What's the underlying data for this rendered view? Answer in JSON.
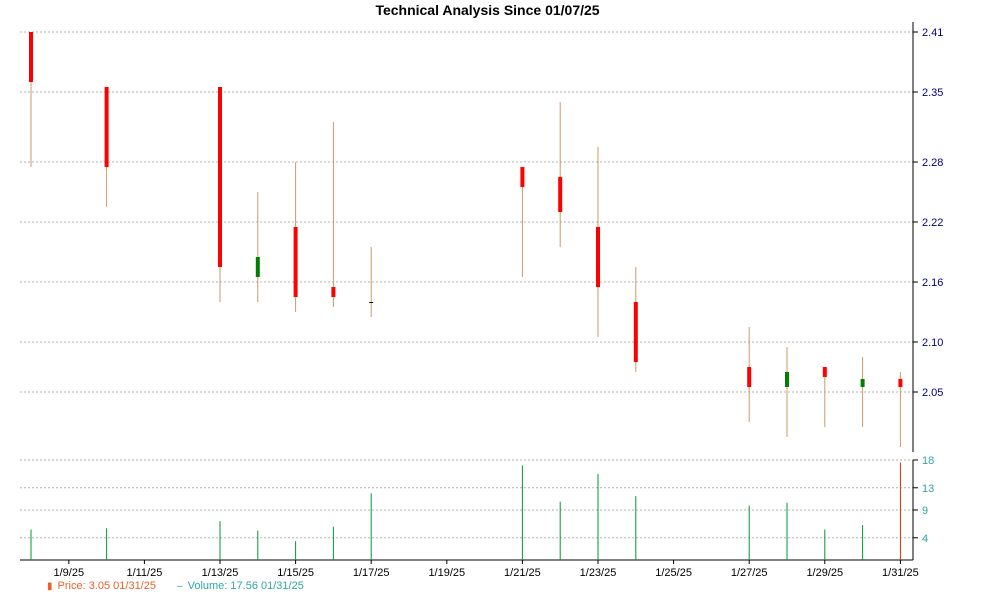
{
  "chart_data": {
    "type": "candlestick",
    "title": "Technical Analysis Since 01/07/25",
    "colors": {
      "up": "#008000",
      "down": "#ff0000",
      "wick": "#cc9966",
      "volume": "#009933",
      "last_volume": "#cc3300",
      "grid": "#b0b0b0",
      "price_axis_text": "#00007a",
      "volume_axis_text": "#2fa6a6"
    },
    "price_axis": {
      "ticks": [
        "2.41",
        "2.35",
        "2.28",
        "2.22",
        "2.16",
        "2.10",
        "2.05"
      ],
      "ylim": [
        1.99,
        2.42
      ],
      "side": "right"
    },
    "volume_axis": {
      "ticks": [
        "18",
        "13",
        "9",
        "4"
      ],
      "ylim": [
        0,
        18
      ],
      "side": "right"
    },
    "x_labels": [
      "1/9/25",
      "1/11/25",
      "1/13/25",
      "1/15/25",
      "1/17/25",
      "1/19/25",
      "1/21/25",
      "1/23/25",
      "1/25/25",
      "1/27/25",
      "1/29/25",
      "1/31/25"
    ],
    "candles": [
      {
        "date": "1/8/25",
        "open": 2.41,
        "high": 2.41,
        "low": 2.275,
        "close": 2.36,
        "volume": 5.5
      },
      {
        "date": "1/10/25",
        "open": 2.355,
        "high": 2.355,
        "low": 2.235,
        "close": 2.275,
        "volume": 5.7
      },
      {
        "date": "1/13/25",
        "open": 2.355,
        "high": 2.355,
        "low": 2.14,
        "close": 2.175,
        "volume": 7.0
      },
      {
        "date": "1/14/25",
        "open": 2.165,
        "high": 2.25,
        "low": 2.14,
        "close": 2.185,
        "volume": 5.3
      },
      {
        "date": "1/15/25",
        "open": 2.215,
        "high": 2.28,
        "low": 2.13,
        "close": 2.145,
        "volume": 3.4
      },
      {
        "date": "1/16/25",
        "open": 2.155,
        "high": 2.32,
        "low": 2.135,
        "close": 2.145,
        "volume": 6.0
      },
      {
        "date": "1/17/25",
        "open": 2.14,
        "high": 2.195,
        "low": 2.125,
        "close": 2.14,
        "volume": 12.0
      },
      {
        "date": "1/21/25",
        "open": 2.275,
        "high": 2.275,
        "low": 2.165,
        "close": 2.255,
        "volume": 17.0
      },
      {
        "date": "1/22/25",
        "open": 2.265,
        "high": 2.34,
        "low": 2.195,
        "close": 2.23,
        "volume": 10.5
      },
      {
        "date": "1/23/25",
        "open": 2.215,
        "high": 2.295,
        "low": 2.105,
        "close": 2.155,
        "volume": 15.5
      },
      {
        "date": "1/24/25",
        "open": 2.14,
        "high": 2.175,
        "low": 2.07,
        "close": 2.08,
        "volume": 11.5
      },
      {
        "date": "1/27/25",
        "open": 2.075,
        "high": 2.115,
        "low": 2.02,
        "close": 2.055,
        "volume": 9.8
      },
      {
        "date": "1/28/25",
        "open": 2.055,
        "high": 2.095,
        "low": 2.005,
        "close": 2.07,
        "volume": 10.3
      },
      {
        "date": "1/29/25",
        "open": 2.075,
        "high": 2.075,
        "low": 2.015,
        "close": 2.065,
        "volume": 5.5
      },
      {
        "date": "1/30/25",
        "open": 2.055,
        "high": 2.085,
        "low": 2.015,
        "close": 2.063,
        "volume": 6.3
      },
      {
        "date": "1/31/25",
        "open": 2.063,
        "high": 2.07,
        "low": 1.995,
        "close": 2.055,
        "volume": 17.56
      }
    ],
    "legend": [
      {
        "label": "Price: 3.05  01/31/25",
        "series": "price"
      },
      {
        "label": "Volume: 17.56  01/31/25",
        "series": "volume"
      }
    ],
    "grid": true
  }
}
